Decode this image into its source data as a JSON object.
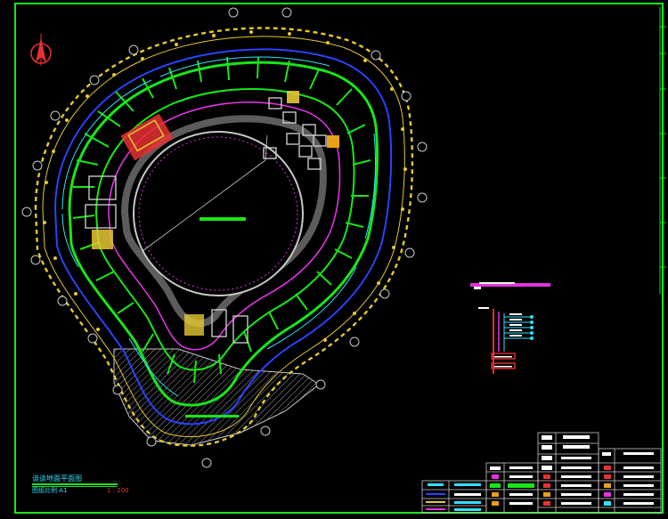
{
  "title_block": {
    "drawing_title": "谈谈地面平面图",
    "scale_left": "图纸比例  A1",
    "scale_right": "1 : 200"
  },
  "colors": {
    "frame": "#19e619",
    "wall_outer": "#e6c833",
    "corridor": "#2a43ff",
    "room": "#19e619",
    "accent": "#e033e0",
    "cyan": "#33e0ff",
    "equipment": "#e6a019",
    "fill": "#c8c8c8",
    "red": "#e83030"
  },
  "north_arrow": {
    "icon": "north-arrow-icon"
  },
  "callout": {
    "label": ""
  }
}
